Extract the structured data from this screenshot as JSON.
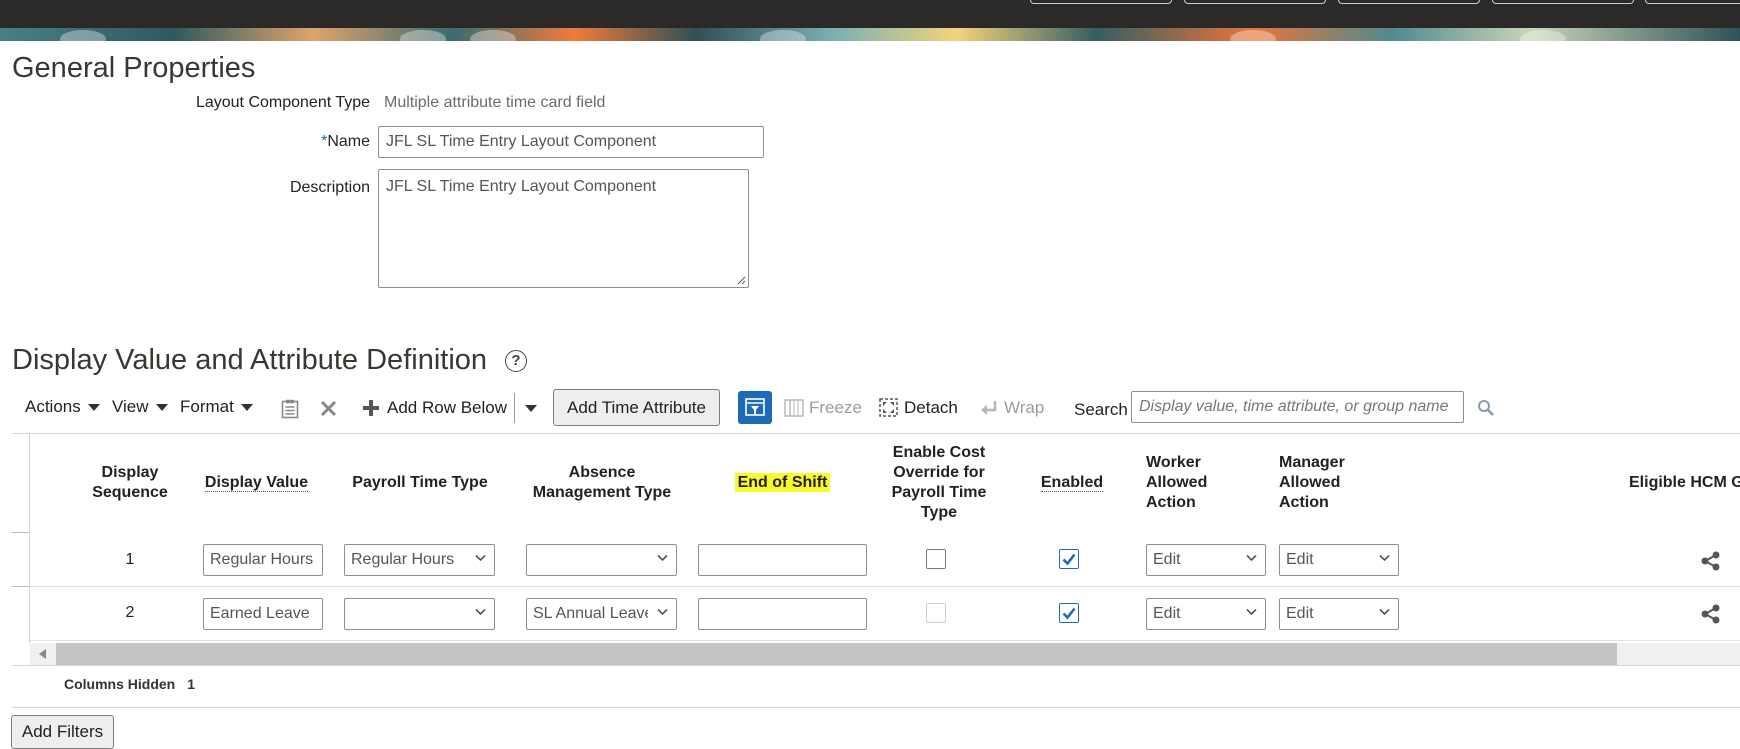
{
  "general": {
    "heading": "General Properties",
    "component_type_label": "Layout Component Type",
    "component_type_value": "Multiple attribute time card field",
    "name_required_mark": "*",
    "name_label": "Name",
    "name_value": "JFL SL Time Entry Layout Component",
    "description_label": "Description",
    "description_value": "JFL SL Time Entry Layout Component"
  },
  "section": {
    "heading": "Display Value and Attribute Definition",
    "help_glyph": "?"
  },
  "toolbar": {
    "actions": "Actions",
    "view": "View",
    "format": "Format",
    "add_row_below": "Add Row Below",
    "add_time_attribute": "Add Time Attribute",
    "freeze": "Freeze",
    "detach": "Detach",
    "wrap": "Wrap",
    "search_label": "Search",
    "search_placeholder": "Display value, time attribute, or group name"
  },
  "table": {
    "headers": {
      "display_sequence": "Display Sequence",
      "display_value": "Display Value",
      "payroll_time_type": "Payroll Time Type",
      "absence_management_type": "Absence Management Type",
      "end_of_shift": "End of Shift",
      "enable_cost_override": "Enable Cost Override for Payroll Time Type",
      "enabled": "Enabled",
      "worker_allowed_action": "Worker Allowed Action",
      "manager_allowed_action": "Manager Allowed Action",
      "eligible_hcm": "Eligible HCM G"
    },
    "rows": [
      {
        "sequence": "1",
        "display_value": "Regular Hours",
        "payroll_time_type": "Regular Hours",
        "absence_management_type": "",
        "end_of_shift": "",
        "enable_cost_override": false,
        "enable_cost_override_disabled": false,
        "enabled": true,
        "worker_allowed_action": "Edit",
        "manager_allowed_action": "Edit"
      },
      {
        "sequence": "2",
        "display_value": "Earned Leave",
        "payroll_time_type": "",
        "absence_management_type": "SL Annual Leave",
        "end_of_shift": "",
        "enable_cost_override": false,
        "enable_cost_override_disabled": true,
        "enabled": true,
        "worker_allowed_action": "Edit",
        "manager_allowed_action": "Edit"
      }
    ],
    "columns_hidden_label": "Columns Hidden",
    "columns_hidden_count": "1"
  },
  "filters": {
    "add_filters": "Add Filters"
  },
  "colors": {
    "highlight": "#fbf92e",
    "accent_blue": "#1d6bb5",
    "topbar": "#2b2a28"
  }
}
